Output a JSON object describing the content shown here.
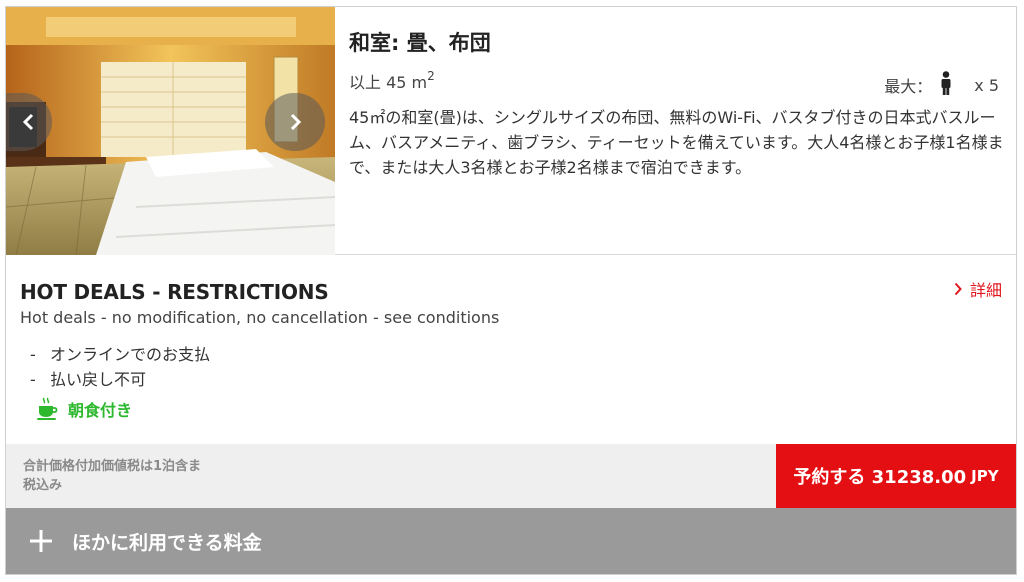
{
  "room": {
    "title": "和室: 畳、布団",
    "size_prefix": "以上 45 m",
    "size_exponent": "2",
    "max_label": "最大：",
    "max_count": "x 5",
    "description": "45㎡の和室(畳)は、シングルサイズの布団、無料のWi-Fi、バスタブ付きの日本式バスルーム、バスアメニティ、歯ブラシ、ティーセットを備えています。大人4名様とお子様1名様まで、または大人3名様とお子様2名様まで宿泊できます。",
    "photo_icon": "room-photo",
    "prev_icon": "chevron-left-icon",
    "next_icon": "chevron-right-icon"
  },
  "deal": {
    "title": "HOT DEALS - RESTRICTIONS",
    "subtitle": "Hot deals - no modification, no cancellation - see conditions",
    "details_label": "詳細",
    "conditions": [
      "オンラインでのお支払",
      "払い戻し不可"
    ],
    "breakfast_label": "朝食付き"
  },
  "price": {
    "tax_note_line1": "合計価格付加価値税は1泊含ま",
    "tax_note_line2": "税込み",
    "book_label": "予約する 31238.00",
    "currency": "JPY"
  },
  "more_rates": {
    "label": "ほかに利用できる料金"
  },
  "colors": {
    "accent_red": "#e40f12",
    "breakfast_green": "#2eb82e",
    "more_rates_bg": "#9a9a9a"
  }
}
